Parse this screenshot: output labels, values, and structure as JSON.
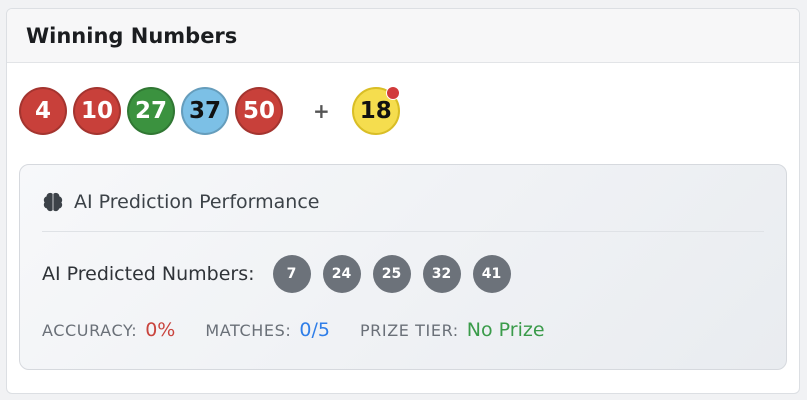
{
  "header": {
    "title": "Winning Numbers"
  },
  "winning": {
    "numbers": [
      {
        "value": "4",
        "color": "#c8403a"
      },
      {
        "value": "10",
        "color": "#c8403a"
      },
      {
        "value": "27",
        "color": "#3b923f"
      },
      {
        "value": "37",
        "color": "#7cc0e6",
        "text_color": "#111111"
      },
      {
        "value": "50",
        "color": "#c8403a"
      }
    ],
    "plus": "+",
    "bonus": {
      "value": "18",
      "color": "#f5dd4e"
    }
  },
  "ai": {
    "icon": "brain-icon",
    "title": "AI Prediction Performance",
    "predicted_label": "AI Predicted Numbers:",
    "predicted": [
      "7",
      "24",
      "25",
      "32",
      "41"
    ],
    "accuracy_label": "ACCURACY:",
    "accuracy_value": "0%",
    "matches_label": "MATCHES:",
    "matches_value": "0/5",
    "prize_label": "PRIZE TIER:",
    "prize_value": "No Prize"
  }
}
